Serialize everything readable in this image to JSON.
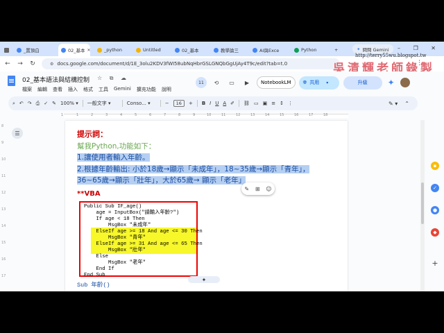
{
  "browser": {
    "tabs": [
      {
        "label": "_置頂白",
        "active": false,
        "color": "#4285f4"
      },
      {
        "label": "02_基本",
        "active": true,
        "color": "#4285f4"
      },
      {
        "label": "_python",
        "active": false,
        "color": "#f4b400"
      },
      {
        "label": "Untitled",
        "active": false,
        "color": "#f4b400"
      },
      {
        "label": "02_基本",
        "active": false,
        "color": "#4285f4"
      },
      {
        "label": "教學論三",
        "active": false,
        "color": "#4285f4"
      },
      {
        "label": "AI與Exce",
        "active": false,
        "color": "#4285f4"
      },
      {
        "label": "Python",
        "active": false,
        "color": "#0f9d58"
      }
    ],
    "gemini_label": "問問 Gemini",
    "window_controls": "– ❐ ✕",
    "url": "docs.google.com/document/d/1E_3olu2KDV3fWI58ubNqHbrGSLGNQbGgUjAy4T9c/edit?tab=t.0"
  },
  "watermark": {
    "url": "http://terry55wu.blogspot.tw",
    "signature": "吳清輝老師錄製"
  },
  "docs": {
    "title": "02_基本語法與結構控制",
    "title_icons": "☆ ⧉ ☁",
    "menu": [
      "檔案",
      "編輯",
      "查看",
      "插入",
      "格式",
      "工具",
      "Gemini",
      "擴充功能",
      "說明"
    ],
    "comment_count": "11",
    "notebook_label": "NotebookLM",
    "share_label": "共用",
    "upgrade_label": "升級"
  },
  "toolbar": {
    "zoom": "100%",
    "style": "一般文字",
    "font": "Conso...",
    "size": "16",
    "bold": "B",
    "italic": "I",
    "underline": "U",
    "text_color": "A"
  },
  "ruler": {
    "numbers": [
      "1",
      "1",
      "2",
      "3",
      "4",
      "5",
      "6",
      "7",
      "8",
      "9",
      "10",
      "11",
      "12",
      "13",
      "14",
      "15",
      "16",
      "17",
      "18"
    ]
  },
  "vruler": {
    "numbers": [
      "8",
      "9",
      "10",
      "11",
      "12",
      "13",
      "14",
      "15",
      "16",
      "17"
    ]
  },
  "document": {
    "prompt_title": "提示詞：",
    "intro": "幫我Python,功能如下：",
    "item1": "1.讓使用者輸入年齡。",
    "item2a": "2.根據年齡輸出: 小於18歲→顯示「未成年」，18~35歲→顯示「青年」，",
    "item2b": "36~65歲→顯示「壯年」，大於65歲→ 顯示「老年」",
    "vba_title": "**VBA",
    "code": [
      "Public Sub IF_age()",
      "    age = InputBox(\"請輸入年齡?\")",
      "    If age < 18 Then",
      "        MsgBox \"未成年\"",
      "    ElseIf age >= 18 And age <= 30 Then",
      "        MsgBox \"青年\"",
      "    ElseIf age >= 31 And age <= 65 Then",
      "        MsgBox \"壯年\"",
      "    Else",
      "        MsgBox \"老年\"",
      "    End If",
      "End Sub"
    ],
    "sub_line": "Sub 年齡()"
  }
}
